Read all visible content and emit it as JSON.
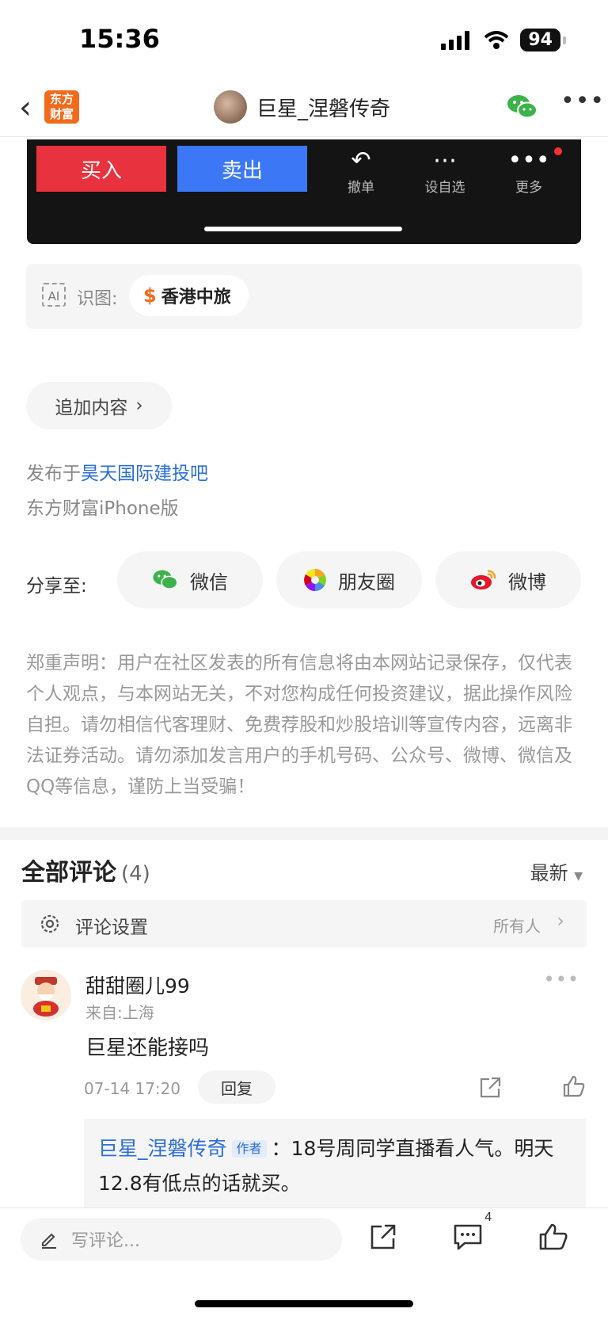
{
  "status_bar": {
    "time": "15:36",
    "battery": "94"
  },
  "header": {
    "back_icon": "chevron-left-icon",
    "logo_text": "东方\n财富",
    "title": "巨星_涅磐传奇"
  },
  "trade_panel": {
    "buy": "买入",
    "sell": "卖出",
    "actions": [
      {
        "label": "撤单",
        "icon": "undo-icon"
      },
      {
        "label": "设自选",
        "icon": "ellipsis-circle-icon"
      },
      {
        "label": "更多",
        "icon": "more-dots-icon"
      }
    ]
  },
  "ai_recognition": {
    "icon_text": "AI",
    "label": "识图:",
    "stock": "香港中旅",
    "stock_symbol": "$"
  },
  "add_content": {
    "label": "追加内容"
  },
  "publish": {
    "prefix": "发布于",
    "forum": "昊天国际建投吧",
    "client": "东方财富iPhone版"
  },
  "share": {
    "label": "分享至:",
    "targets": [
      {
        "label": "微信",
        "icon": "wechat-icon"
      },
      {
        "label": "朋友圈",
        "icon": "moments-icon"
      },
      {
        "label": "微博",
        "icon": "weibo-icon"
      }
    ]
  },
  "disclaimer": "郑重声明：用户在社区发表的所有信息将由本网站记录保存，仅代表个人观点，与本网站无关，不对您构成任何投资建议，据此操作风险自担。请勿相信代客理财、免费荐股和炒股培训等宣传内容，远离非法证券活动。请勿添加发言用户的手机号码、公众号、微博、微信及QQ等信息，谨防上当受骗！",
  "comments": {
    "title": "全部评论",
    "count": "(4)",
    "sort": "最新",
    "settings": {
      "label": "评论设置",
      "value": "所有人"
    },
    "items": [
      {
        "user": "甜甜圈儿99",
        "location": "来自:上海",
        "text": "巨星还能接吗",
        "time": "07-14 17:20",
        "reply_label": "回复",
        "reply": {
          "author": "巨星_涅磐传奇",
          "badge": "作者",
          "separator": "：",
          "text": "18号周同学直播看人气。明天12.8有低点的话就买。"
        }
      }
    ]
  },
  "bottom_bar": {
    "placeholder": "写评论...",
    "comment_count": "4"
  },
  "colors": {
    "brand": "#f36a1c",
    "buy": "#e8323d",
    "sell": "#3c78f5",
    "link": "#2b6ed8"
  }
}
